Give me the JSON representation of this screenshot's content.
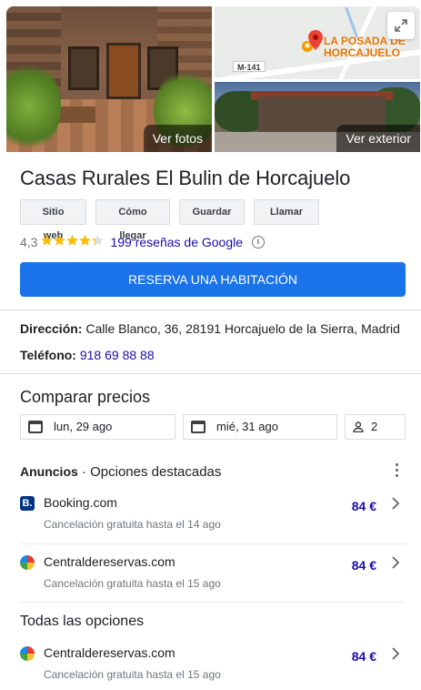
{
  "photos": {
    "main_button": "Ver fotos",
    "exterior_button": "Ver exterior",
    "map": {
      "road_badge": "M-141",
      "place_label_line1": "LA POSADA DE",
      "place_label_line2": "HORCAJUELO"
    }
  },
  "title": "Casas Rurales El Bulin de Horcajuelo",
  "actions": {
    "website": "Sitio web",
    "directions": "Cómo llegar",
    "save": "Guardar",
    "call": "Llamar"
  },
  "rating": {
    "score": "4,3",
    "stars_value": 4.3,
    "stars_max": 5,
    "reviews": "199 reseñas de Google"
  },
  "reserve_button": "RESERVA UNA HABITACIÓN",
  "address": {
    "label": "Dirección:",
    "value": "Calle Blanco, 36, 28191 Horcajuelo de la Sierra, Madrid"
  },
  "phone": {
    "label": "Teléfono:",
    "value": "918 69 88 88"
  },
  "compare": {
    "title": "Comparar precios",
    "checkin": "lun, 29 ago",
    "checkout": "mié, 31 ago",
    "guests": "2"
  },
  "ads": {
    "label": "Anuncios",
    "separator": "·",
    "subtitle": "Opciones destacadas"
  },
  "featured_offers": [
    {
      "provider": "Booking.com",
      "logo_letter": "B.",
      "cancellation": "Cancelación gratuita hasta el 14 ago",
      "price": "84 €"
    },
    {
      "provider": "Centraldereservas.com",
      "cancellation": "Cancelación gratuita hasta el 15 ago",
      "price": "84 €"
    }
  ],
  "all_options": {
    "title": "Todas las opciones",
    "offers": [
      {
        "provider": "Centraldereservas.com",
        "cancellation": "Cancelación gratuita hasta el 15 ago",
        "price": "84 €"
      }
    ]
  },
  "colors": {
    "accent": "#1a73e8",
    "link": "#1a0dab",
    "star": "#fbbc04",
    "booking_brand": "#003580"
  }
}
